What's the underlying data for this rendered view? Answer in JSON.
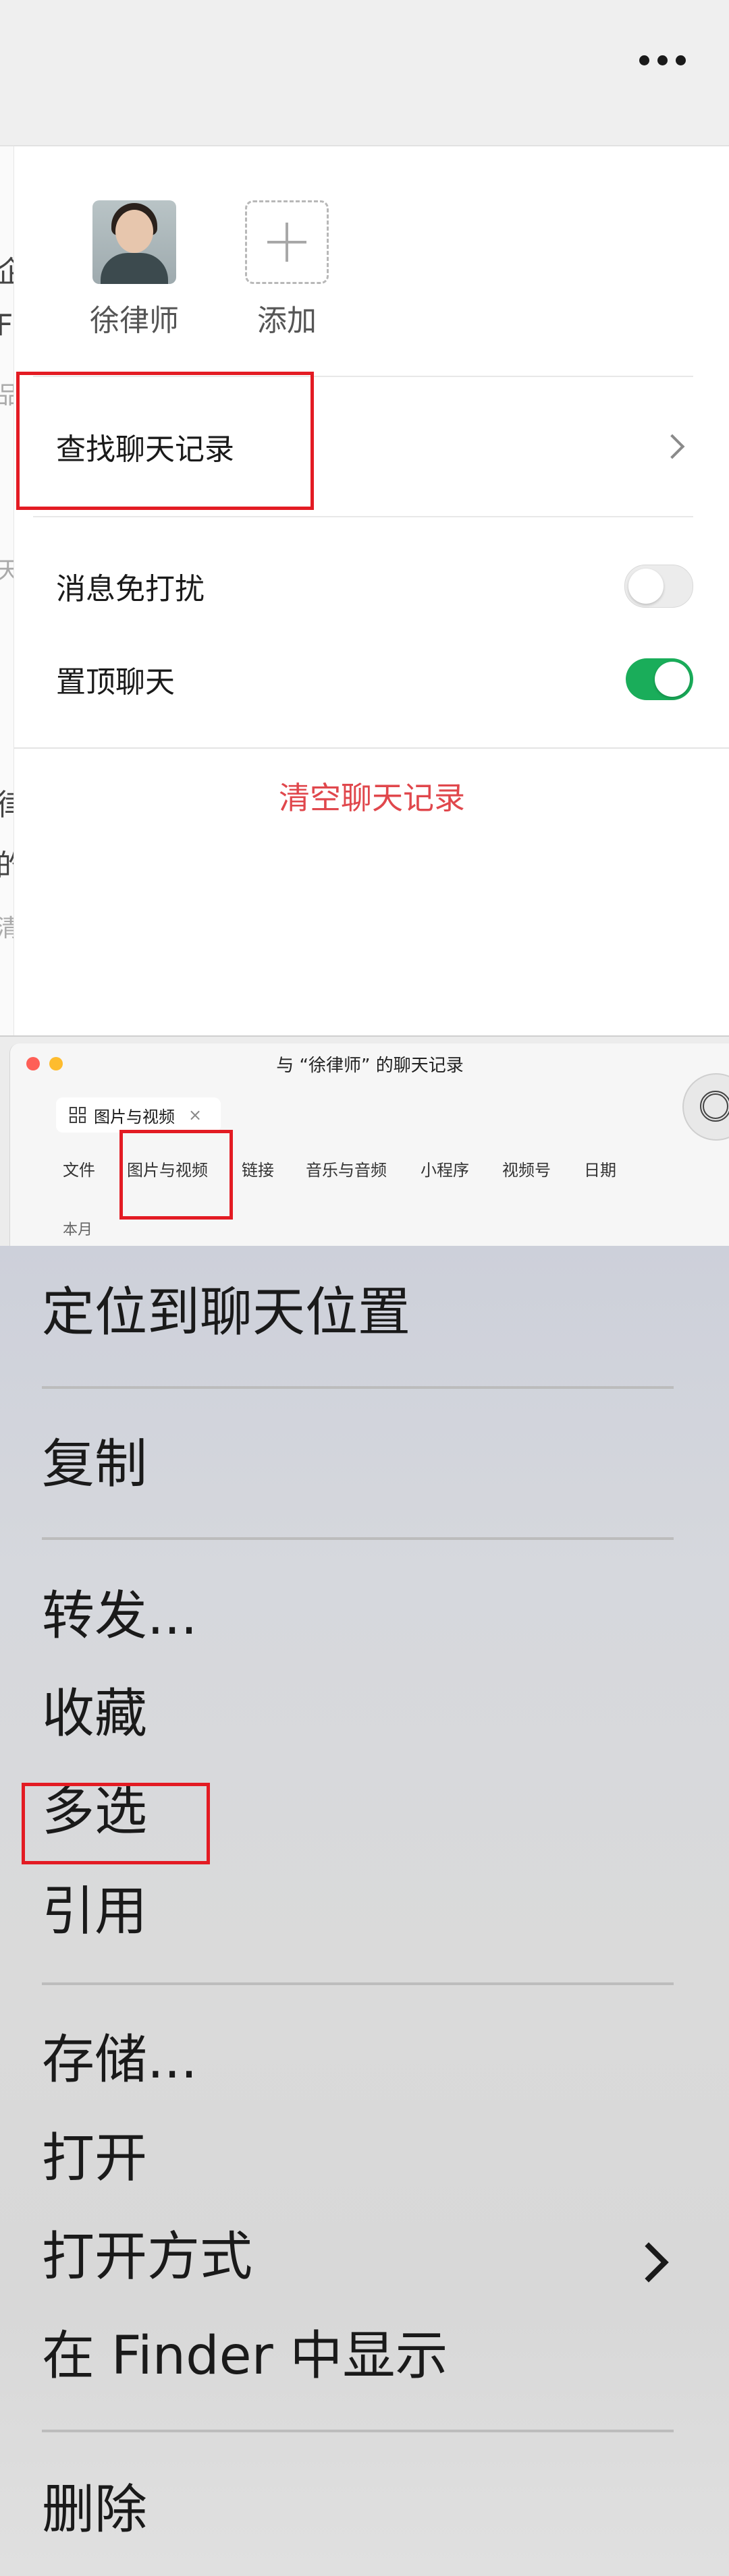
{
  "chat_info": {
    "members": [
      {
        "name": "徐律师"
      },
      {
        "name": "添加"
      }
    ],
    "rows": {
      "search_history": "查找聊天记录",
      "mute": "消息免打扰",
      "mute_on": false,
      "pin": "置顶聊天",
      "pin_on": true
    },
    "clear_history": "清空聊天记录"
  },
  "history_window": {
    "title": "与 “徐律师” 的聊天记录",
    "open_tab": "图片与视频",
    "filter_tabs": [
      "文件",
      "图片与视频",
      "链接",
      "音乐与音频",
      "小程序",
      "视频号",
      "日期"
    ],
    "section_label": "本月"
  },
  "context_menu": {
    "items": [
      "定位到聊天位置",
      "复制",
      "转发...",
      "收藏",
      "多选",
      "引用",
      "存储...",
      "打开",
      "打开方式",
      "在 Finder 中显示",
      "删除"
    ]
  },
  "colors": {
    "highlight": "#e31b23",
    "danger_text": "#e0474c",
    "toggle_on": "#1aad5a"
  }
}
